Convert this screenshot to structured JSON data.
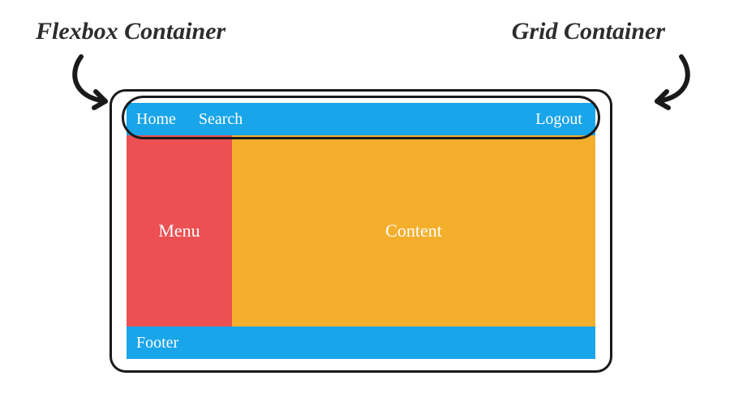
{
  "labels": {
    "flexbox": "Flexbox Container",
    "grid": "Grid Container"
  },
  "nav": {
    "home": "Home",
    "search": "Search",
    "logout": "Logout"
  },
  "regions": {
    "menu": "Menu",
    "content": "Content",
    "footer": "Footer"
  },
  "colors": {
    "blue": "#18a5ea",
    "red": "#ec5053",
    "orange": "#f3af2c",
    "outline": "#1a1a1a"
  }
}
